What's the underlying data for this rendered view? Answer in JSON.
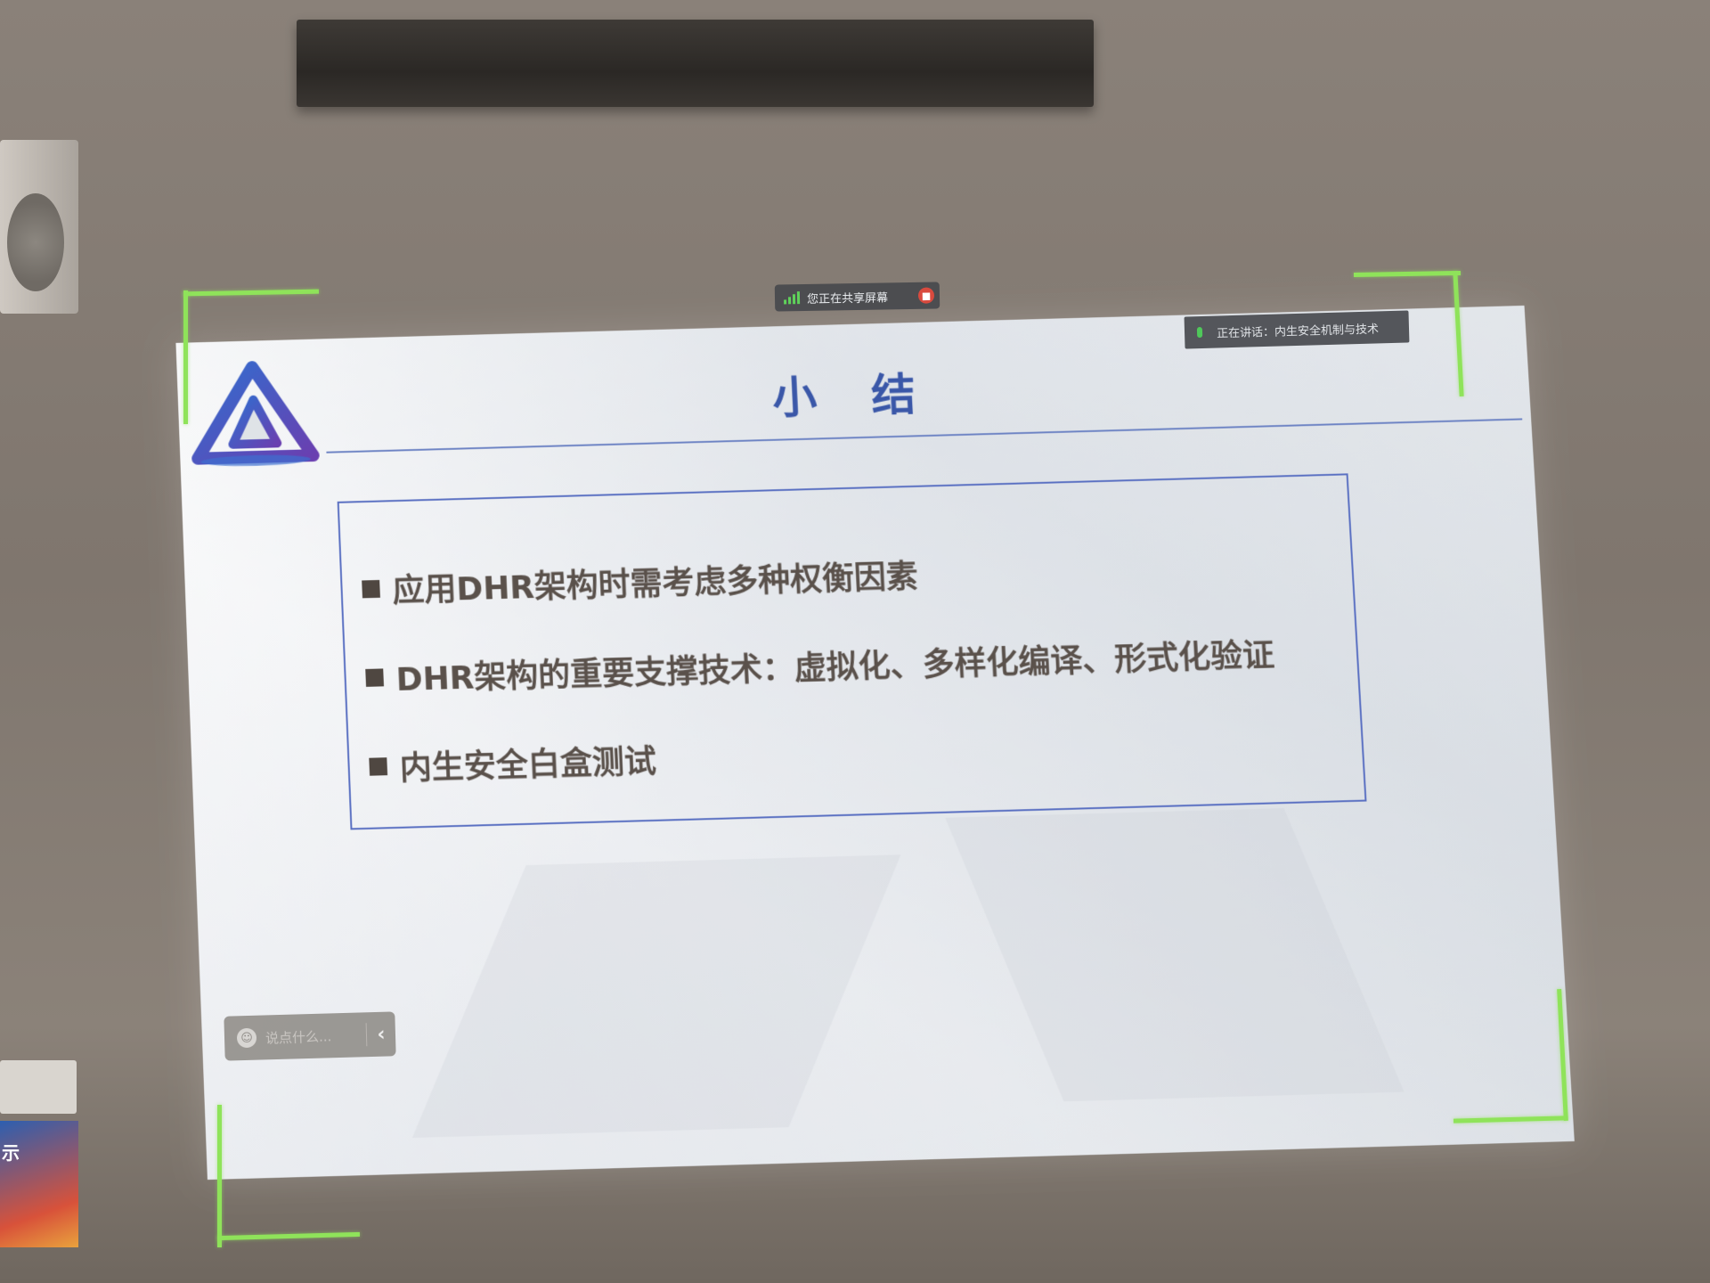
{
  "share_bar": {
    "status": "您正在共享屏幕"
  },
  "speaking_bar": {
    "label": "正在讲话：内生安全机制与技术"
  },
  "slide": {
    "title": "小 结",
    "bullets": [
      "应用DHR架构时需考虑多种权衡因素",
      "DHR架构的重要支撑技术：虚拟化、多样化编译、形式化验证",
      "内生安全白盒测试"
    ]
  },
  "chat": {
    "placeholder": "说点什么..."
  },
  "poster": {
    "text": "示"
  },
  "colors": {
    "title_blue": "#3a57a8",
    "box_border": "#5a70c2",
    "bracket_green": "#8fe35a",
    "bullet_text": "#5a514b"
  },
  "icons": [
    "signal-icon",
    "stop-share-icon",
    "mic-icon",
    "logo-icon",
    "emoji-icon",
    "chevron-left-icon"
  ]
}
